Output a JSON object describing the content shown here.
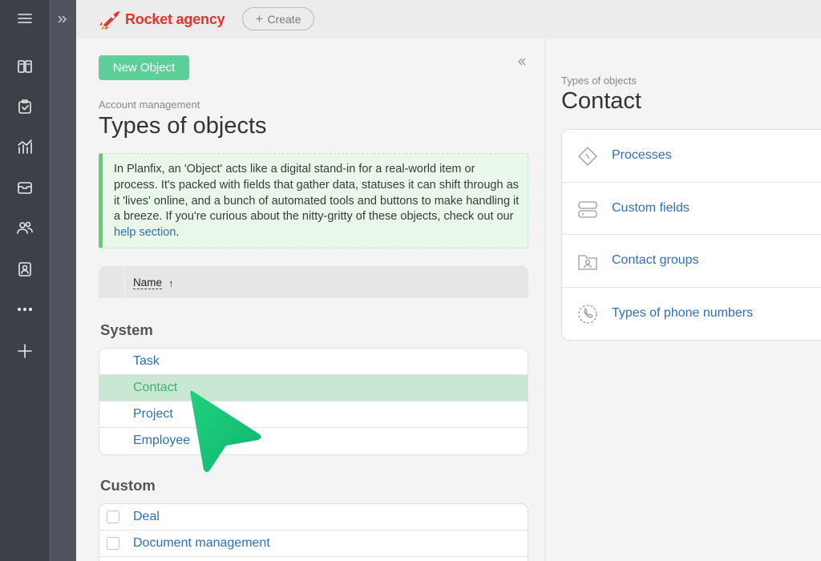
{
  "header": {
    "app_name": "Rocket agency",
    "create_label": "Create",
    "brand_color": "#e5342c"
  },
  "main": {
    "new_object_label": "New Object",
    "breadcrumb": "Account management",
    "title": "Types of objects",
    "info": {
      "text": "In Planfix, an 'Object' acts like a digital stand-in for a real-world item or process. It's packed with fields that gather data, statuses it can shift through as it 'lives' online, and a bunch of automated tools and buttons to make handling it a breeze. If you're curious about the nitty-gritty of these objects, check out our ",
      "link": "help section",
      "end": "."
    },
    "table_header": {
      "name": "Name",
      "sort_arrow": "↑"
    },
    "system_title": "System",
    "system_items": [
      "Task",
      "Contact",
      "Project",
      "Employee"
    ],
    "selected_item": "Contact",
    "custom_title": "Custom",
    "custom_items": [
      "Deal",
      "Document management"
    ]
  },
  "detail": {
    "breadcrumb": "Types of objects",
    "title": "Contact",
    "settings": [
      {
        "label": "Processes",
        "icon": "processes-icon"
      },
      {
        "label": "Custom fields",
        "icon": "custom-fields-icon"
      },
      {
        "label": "Contact groups",
        "icon": "contact-groups-icon"
      },
      {
        "label": "Types of phone numbers",
        "icon": "phone-icon"
      }
    ]
  },
  "sidebar": {
    "icons": [
      "menu-icon",
      "dashboard-icon",
      "tasks-icon",
      "reports-icon",
      "inbox-icon",
      "contacts-icon",
      "contact-card-icon",
      "more-icon",
      "add-icon"
    ]
  }
}
